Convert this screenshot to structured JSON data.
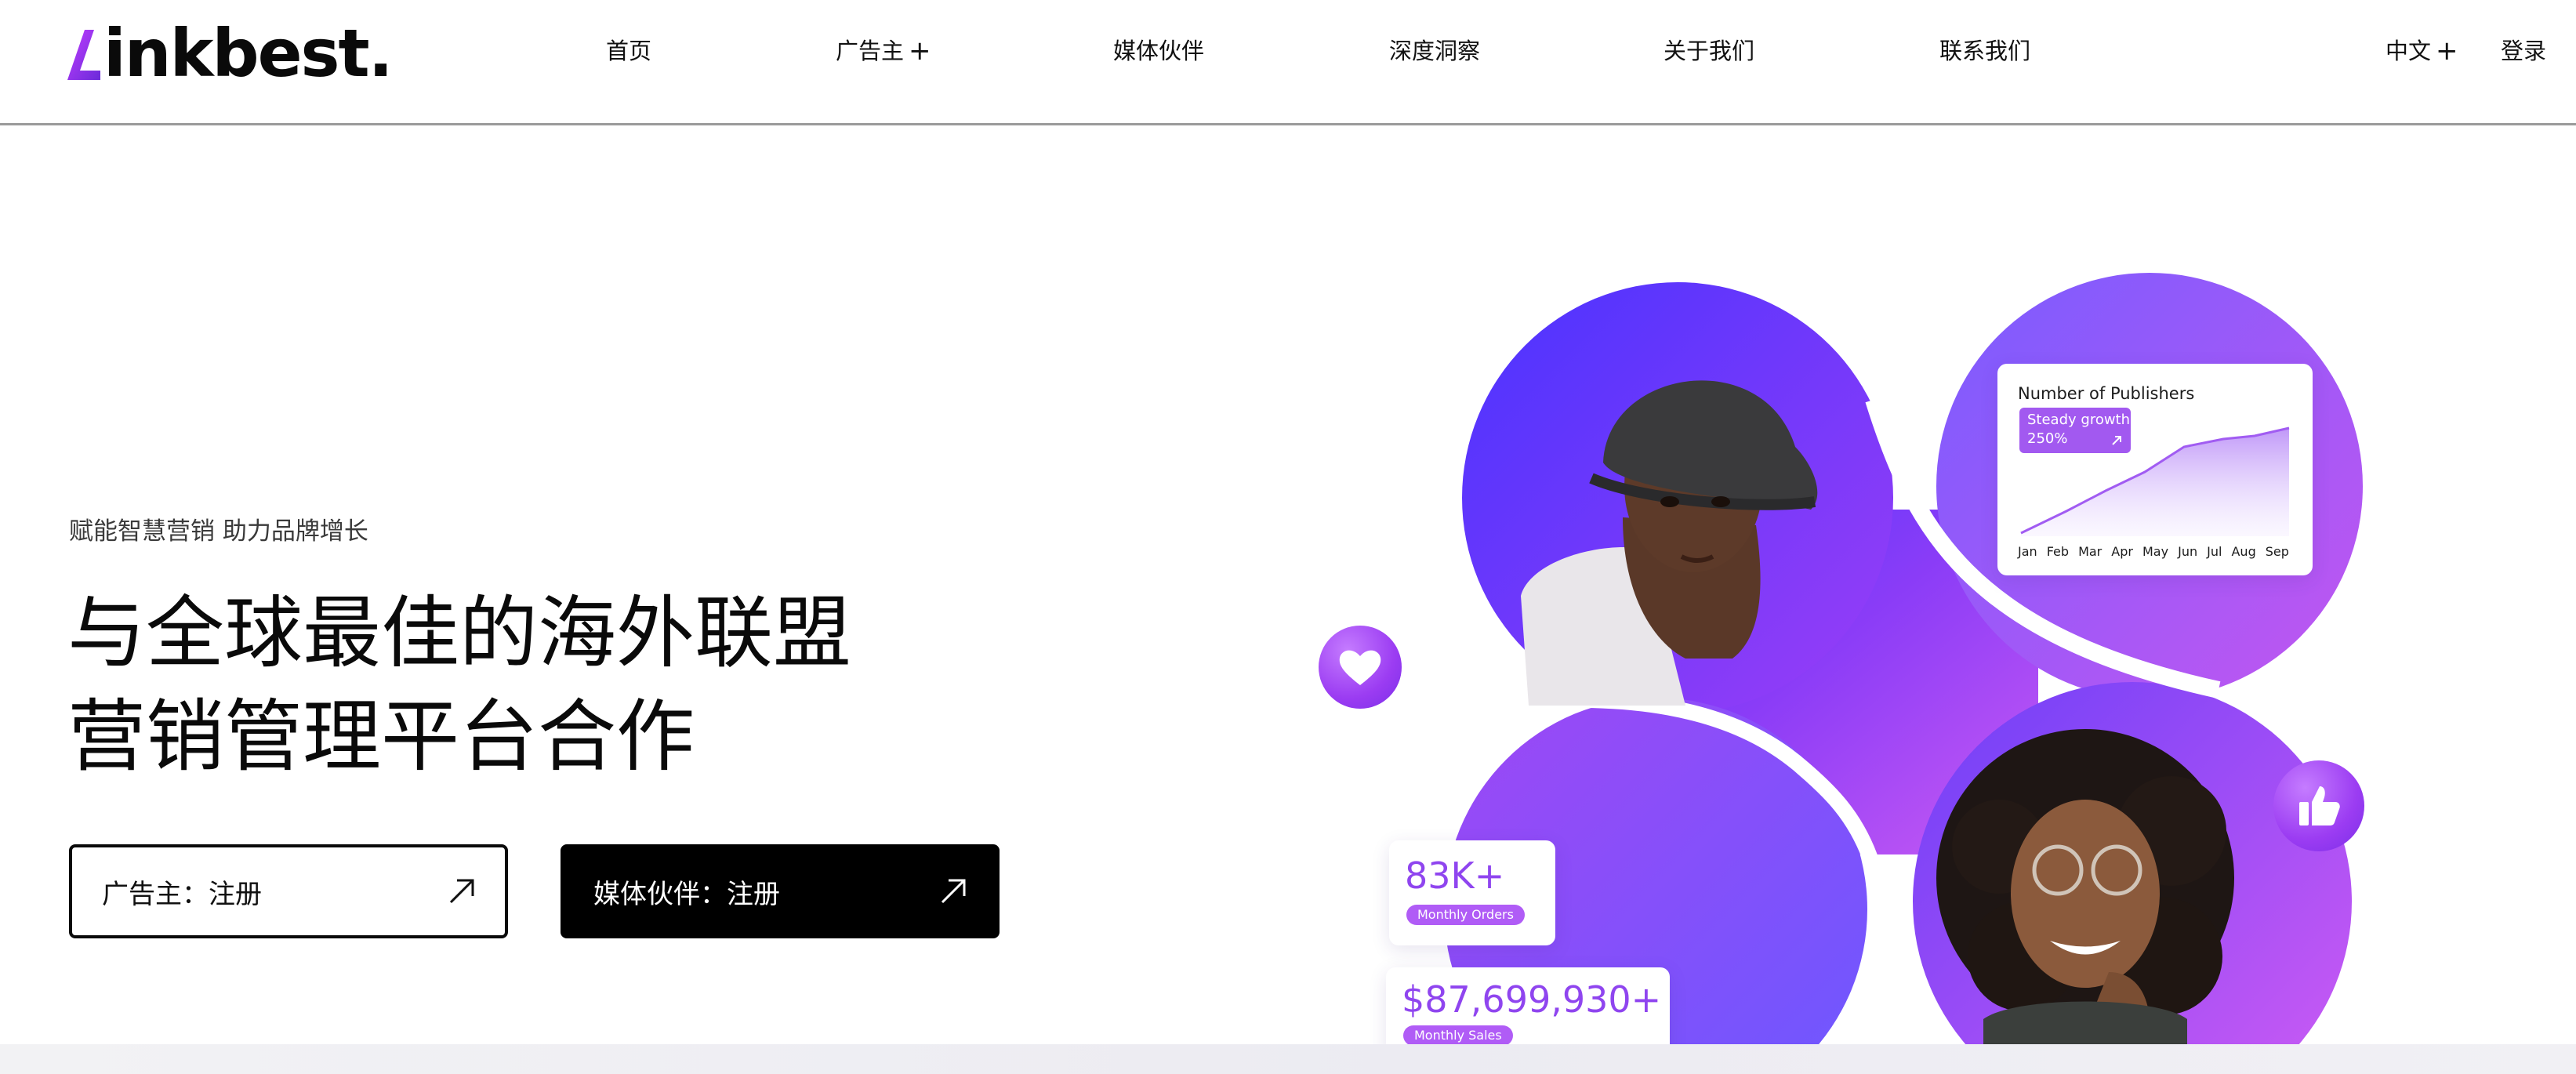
{
  "header": {
    "logo_text": "inkbest.",
    "logo_alt": "Linkbest.",
    "nav": [
      {
        "label": "首页",
        "has_plus": false
      },
      {
        "label": "广告主",
        "has_plus": true
      },
      {
        "label": "媒体伙伴",
        "has_plus": false
      },
      {
        "label": "深度洞察",
        "has_plus": false
      },
      {
        "label": "关于我们",
        "has_plus": false
      },
      {
        "label": "联系我们",
        "has_plus": false
      }
    ],
    "plus_symbol": "+",
    "language": "中文",
    "login": "登录"
  },
  "hero": {
    "tagline": "赋能智慧营销 助力品牌增长",
    "headline_line1": "与全球最佳的海外联盟",
    "headline_line2": "营销管理平台合作",
    "buttons": [
      {
        "label": "广告主：注册",
        "style": "outline"
      },
      {
        "label": "媒体伙伴：注册",
        "style": "solid"
      }
    ]
  },
  "publishers_card": {
    "title": "Number of Publishers",
    "badge_line1": "Steady growth",
    "badge_line2": "250%",
    "months": [
      "Jan",
      "Feb",
      "Mar",
      "Apr",
      "May",
      "Jun",
      "Jul",
      "Aug",
      "Sep"
    ]
  },
  "stats": [
    {
      "value": "83K+",
      "label": "Monthly Orders"
    },
    {
      "value": "$87,699,930+",
      "label": "Monthly Sales"
    }
  ],
  "icons": {
    "heart": "heart-icon",
    "thumb": "thumbs-up-icon",
    "arrow": "arrow-up-right-icon"
  },
  "colors": {
    "brand_purple": "#8f45ef",
    "gradient_start": "#5b3cff",
    "gradient_end": "#c15cf4",
    "text": "#0a0a0a"
  }
}
